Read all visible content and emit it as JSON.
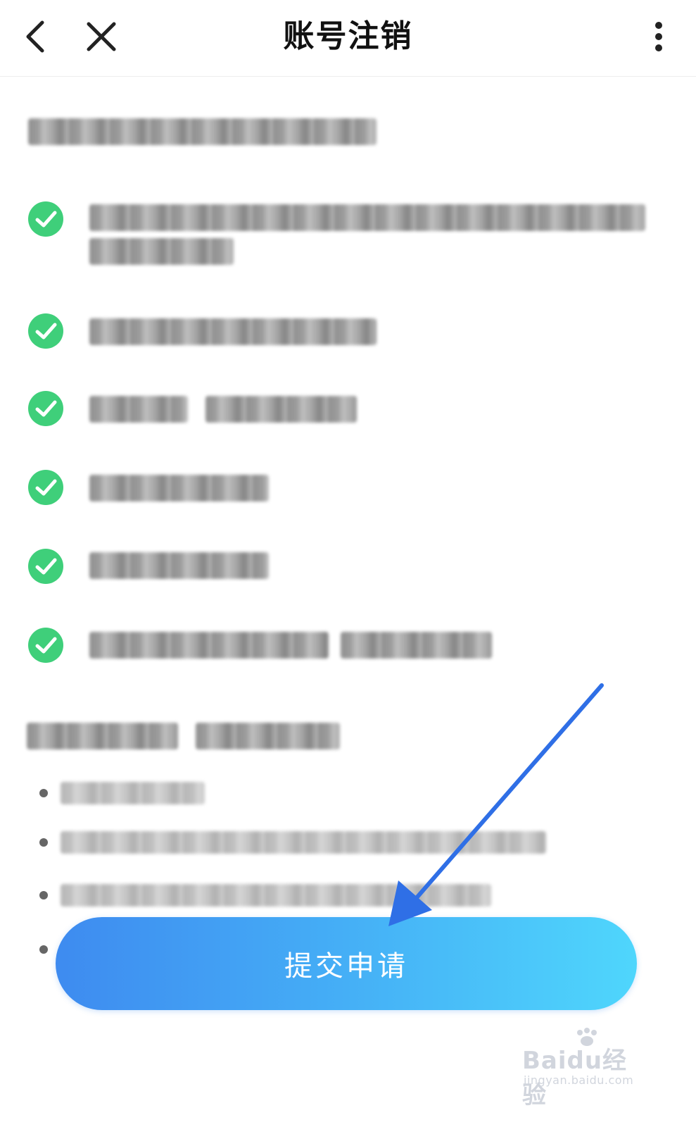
{
  "header": {
    "title": "账号注销",
    "back_icon": "chevron-left-icon",
    "close_icon": "close-icon",
    "more_icon": "more-vertical-icon"
  },
  "content": {
    "checklist_count": 6,
    "note_items_count": 4
  },
  "submit_label": "提交申请",
  "watermark": {
    "brand": "Baidu经验",
    "url": "jingyan.baidu.com"
  },
  "colors": {
    "check_green": "#3fcf7a",
    "button_start": "#3e8bf0",
    "button_end": "#4fd6fc",
    "arrow_blue": "#2f6fe6"
  }
}
